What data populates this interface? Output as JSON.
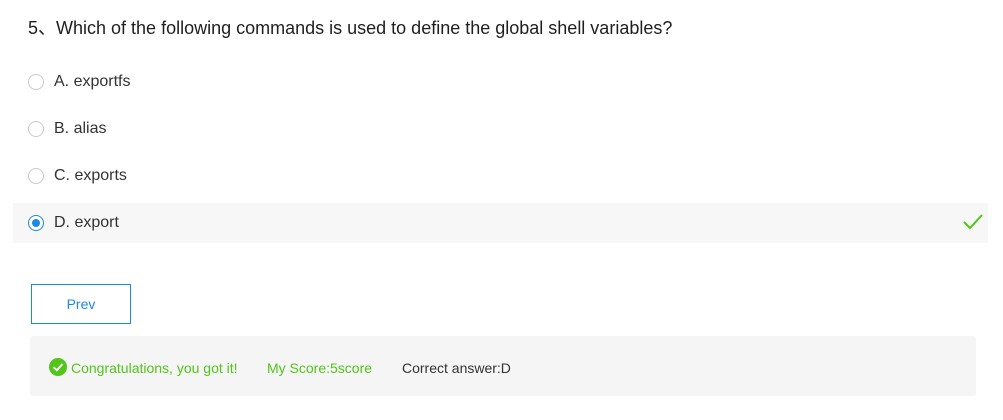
{
  "question": {
    "number": "5、",
    "text": "Which of the following commands is used to define the global shell variables?"
  },
  "options": [
    {
      "label": "A. exportfs",
      "selected": false
    },
    {
      "label": "B. alias",
      "selected": false
    },
    {
      "label": "C. exports",
      "selected": false
    },
    {
      "label": "D. export",
      "selected": true
    }
  ],
  "navigation": {
    "prev_label": "Prev"
  },
  "result": {
    "message": "Congratulations, you got it!",
    "score": "My Score:5score",
    "correct_answer": "Correct answer:D"
  },
  "colors": {
    "accent": "#1e88e5",
    "success": "#52c41a",
    "selected_row_bg": "#f7f7f7",
    "result_bg": "#f5f5f5"
  },
  "icons": {
    "correct_mark": "check-icon",
    "result_status": "success-check-circle-icon"
  }
}
